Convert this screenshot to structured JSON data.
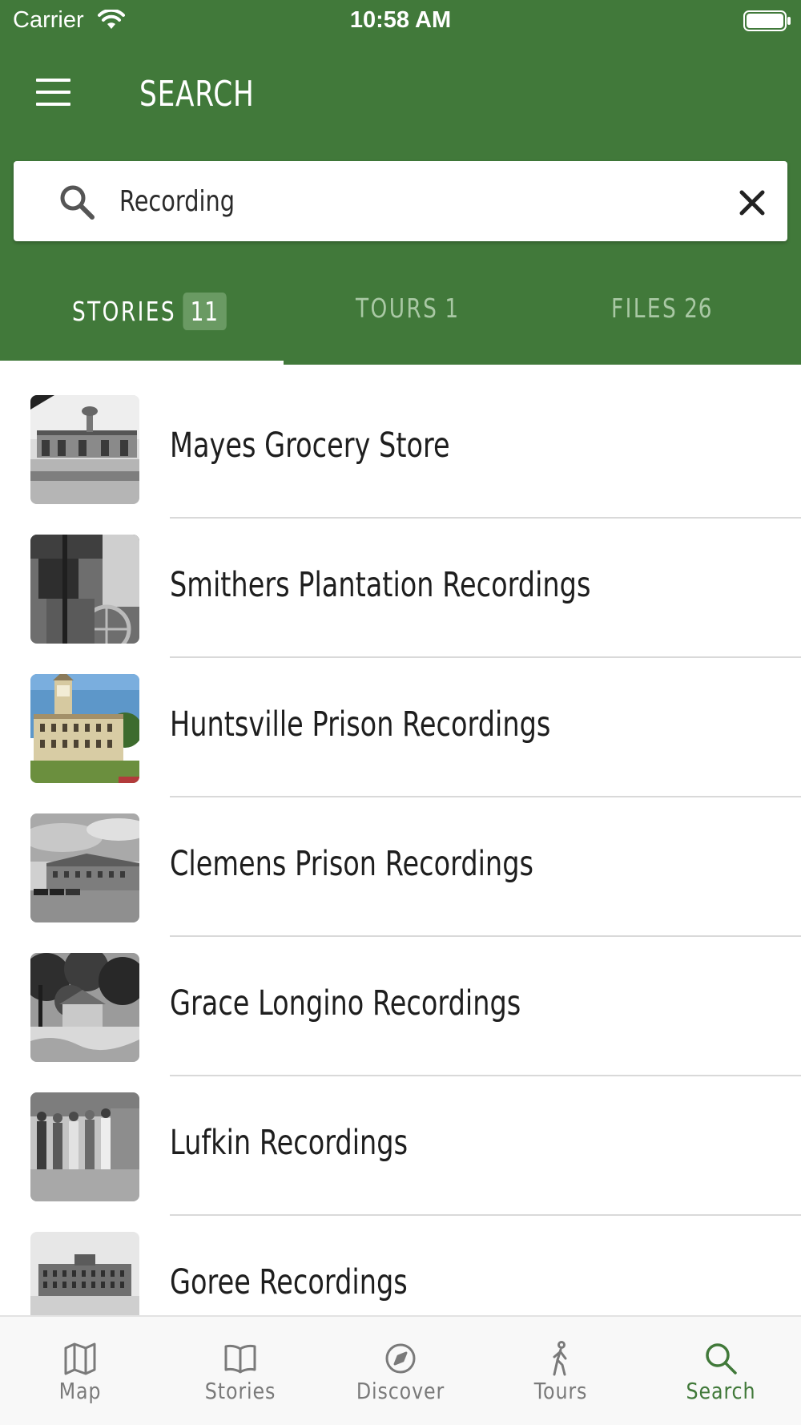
{
  "status_bar": {
    "carrier": "Carrier",
    "time": "10:58 AM"
  },
  "header": {
    "title": "SEARCH"
  },
  "search": {
    "value": "Recording",
    "placeholder": ""
  },
  "tabs": [
    {
      "label": "STORIES",
      "count": "11",
      "active": true
    },
    {
      "label": "TOURS",
      "count": "1",
      "active": false
    },
    {
      "label": "FILES",
      "count": "26",
      "active": false
    }
  ],
  "results": [
    {
      "title": "Mayes Grocery Store",
      "thumb_icon": "storefront-photo"
    },
    {
      "title": "Smithers Plantation Recordings",
      "thumb_icon": "machinery-photo"
    },
    {
      "title": "Huntsville Prison Recordings",
      "thumb_icon": "clocktower-postcard"
    },
    {
      "title": "Clemens Prison Recordings",
      "thumb_icon": "building-photo"
    },
    {
      "title": "Grace Longino Recordings",
      "thumb_icon": "house-trees-photo"
    },
    {
      "title": "Lufkin Recordings",
      "thumb_icon": "group-people-photo"
    },
    {
      "title": "Goree Recordings",
      "thumb_icon": "institution-photo"
    }
  ],
  "tabbar": [
    {
      "label": "Map",
      "icon": "map-icon",
      "selected": false
    },
    {
      "label": "Stories",
      "icon": "book-icon",
      "selected": false
    },
    {
      "label": "Discover",
      "icon": "compass-icon",
      "selected": false
    },
    {
      "label": "Tours",
      "icon": "walking-person-icon",
      "selected": false
    },
    {
      "label": "Search",
      "icon": "search-icon",
      "selected": true
    }
  ],
  "colors": {
    "brand_green": "#41793a",
    "tab_inactive": "#a9c8a4",
    "tabbar_inactive": "#7a7a7a"
  }
}
